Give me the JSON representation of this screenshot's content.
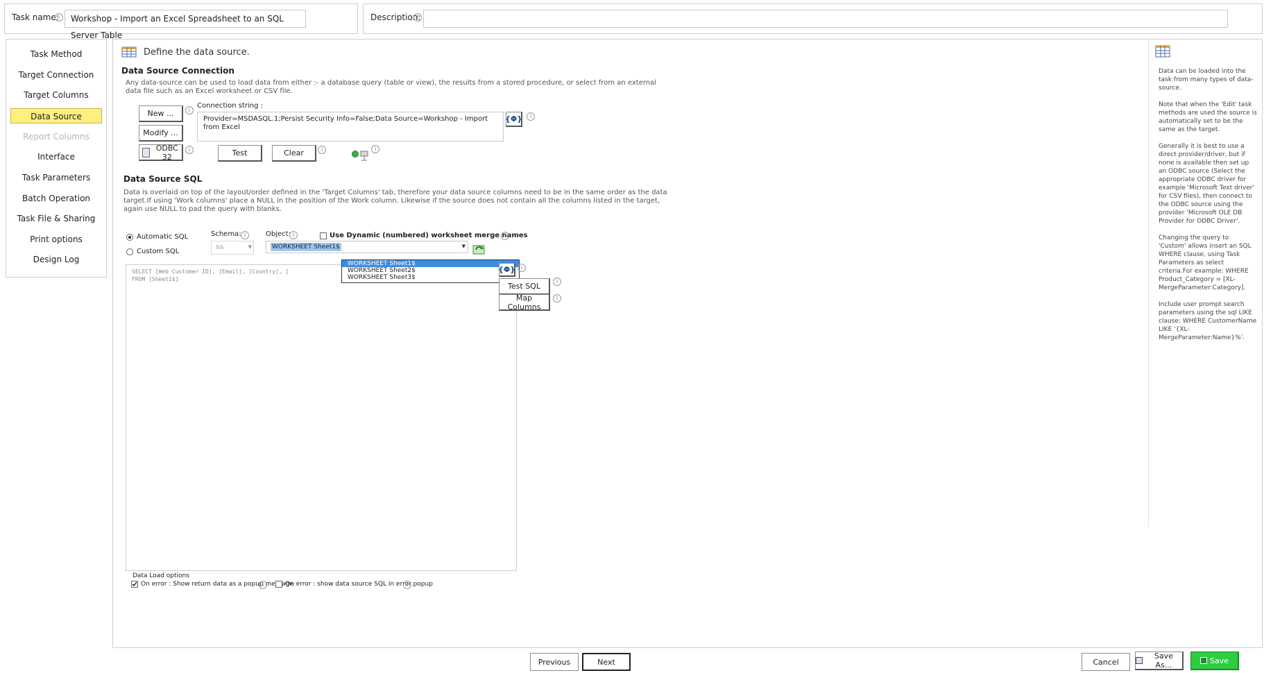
{
  "header": {
    "task_name_label": "Task name:",
    "task_name_value": "Workshop - Import an Excel Spreadsheet to an SQL Server Table",
    "description_label": "Description:",
    "description_value": ""
  },
  "nav": {
    "items": [
      {
        "label": "Task Method",
        "state": "normal"
      },
      {
        "label": "Target Connection",
        "state": "normal"
      },
      {
        "label": "Target Columns",
        "state": "normal"
      },
      {
        "label": "Data Source",
        "state": "active"
      },
      {
        "label": "Report Columns",
        "state": "disabled"
      },
      {
        "label": "Interface",
        "state": "normal"
      },
      {
        "label": "Task Parameters",
        "state": "normal"
      },
      {
        "label": "Batch Operation",
        "state": "normal"
      },
      {
        "label": "Task File & Sharing",
        "state": "normal"
      },
      {
        "label": "Print options",
        "state": "normal"
      },
      {
        "label": "Design Log",
        "state": "normal"
      }
    ]
  },
  "main": {
    "title": "Define the data source.",
    "connection": {
      "heading": "Data Source Connection",
      "description": "Any data-source can be used to load data from either :- a database query (table or view), the results from a stored procedure, or select from an external data file such as an Excel worksheet or CSV file.",
      "new_label": "New ...",
      "modify_label": "Modify ...",
      "odbc_label": "ODBC 32",
      "conn_string_label": "Connection string :",
      "conn_string_value": "Provider=MSDASQL.1;Persist Security Info=False;Data Source=Workshop - Import from Excel",
      "test_label": "Test",
      "clear_label": "Clear",
      "param_label": "{Φ}"
    },
    "sql": {
      "heading": "Data Source SQL",
      "description": "Data is overlaid on top of the layout/order defined in the 'Target Columns' tab,  therefore your data source columns need to be in the same order as the data target.If using 'Work columns' place a NULL in the position of the Work column.  Likewise if the source does not contain all the columns listed in the target, again use NULL to pad the query with blanks.",
      "auto_label": "Automatic SQL",
      "custom_label": "Custom SQL",
      "schema_label": "Schema:",
      "schema_value": "NA",
      "object_label": "Object:",
      "dynamic_label": "Use Dynamic (numbered) worksheet merge names",
      "object_value": "WORKSHEET Sheet1$",
      "options": [
        "WORKSHEET Sheet1$",
        "WORKSHEET Sheet2$",
        "WORKSHEET Sheet3$"
      ],
      "sql_line1": "SELECT [Web Customer ID], [Email], [Country], [",
      "sql_line2": "FROM [Sheet1$]",
      "test_sql_label": "Test SQL",
      "map_columns_label": "Map Columns",
      "param_label": "{Φ}"
    },
    "load_options": {
      "heading": "Data Load options",
      "opt1": "On error : Show return data as a popup message",
      "opt2": "On error : show data source SQL in error popup"
    }
  },
  "help": {
    "paragraphs": [
      "Data can be loaded into the task from many types of data-source.",
      "Note that when the 'Edit' task methods are used the source is automatically set to be the same as the target.",
      "Generally it is best to use a direct provider/driver, but if none is available then set up an ODBC source (Select the appropriate ODBC driver for example 'Microsoft Text driver' for CSV files), then connect to the ODBC source using the provider 'Microsoft OLE DB Provider for ODBC Driver'.",
      "Changing the query to 'Custom' allows insert an SQL WHERE clause, using Task Parameters as select criteria.For example: WHERE Product_Category = [XL-MergeParameter:Category].",
      "Include user prompt search parameters using the sql LIKE clause: WHERE CustomerName LIKE '{XL-MergeParameter:Name}%'."
    ]
  },
  "footer": {
    "previous_label": "Previous",
    "next_label": "Next",
    "cancel_label": "Cancel",
    "save_as_label": "Save As...",
    "save_label": "Save"
  },
  "colors": {
    "active_nav": "#ffee80",
    "selection": "#3d8ee0",
    "save_green": "#2ecc40"
  }
}
